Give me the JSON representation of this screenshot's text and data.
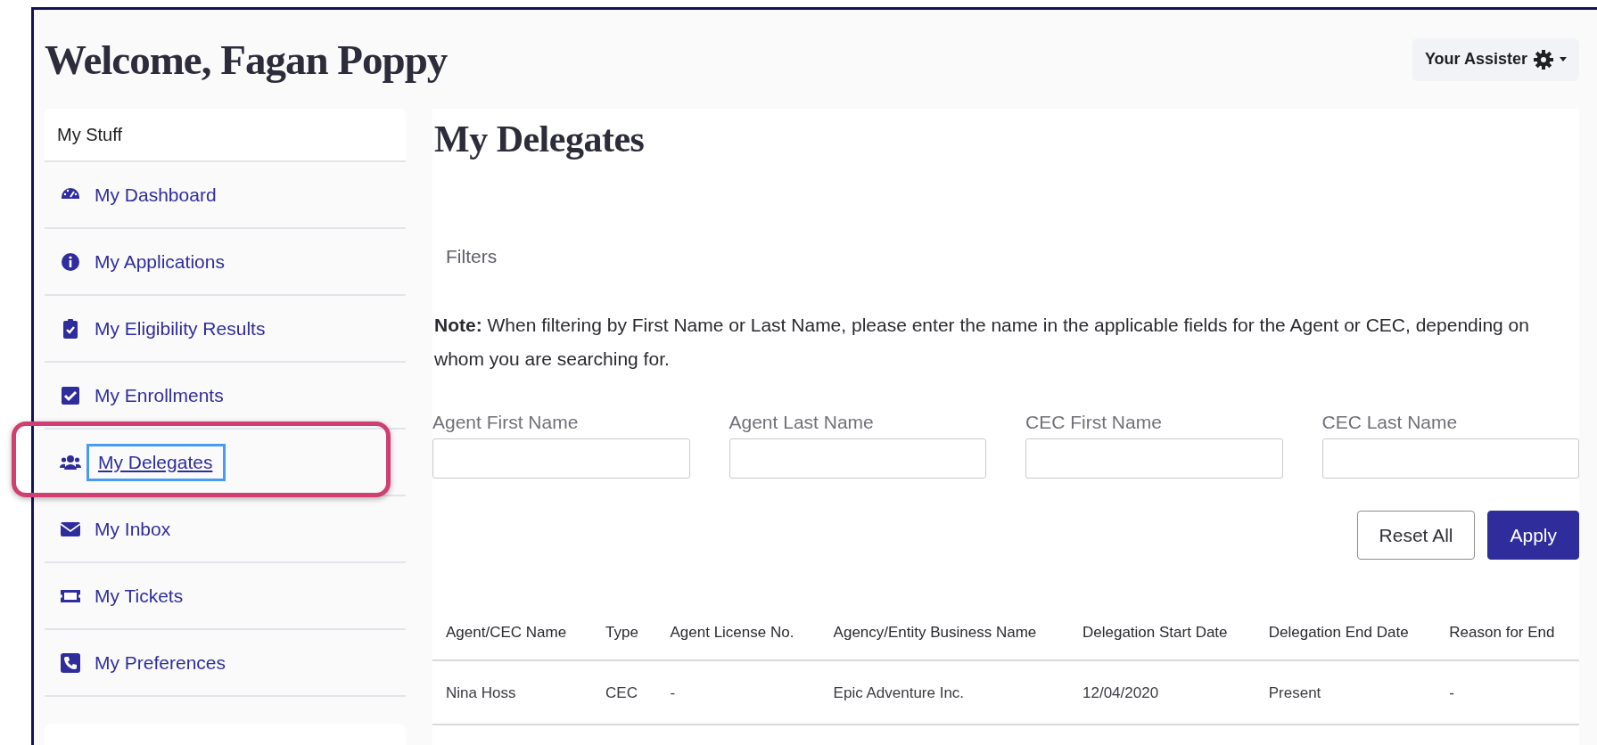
{
  "header": {
    "title": "Welcome, Fagan Poppy",
    "user_menu": "Your Assister"
  },
  "sidebar": {
    "title": "My Stuff",
    "items": [
      {
        "label": "My Dashboard",
        "selected": false
      },
      {
        "label": "My Applications",
        "selected": false
      },
      {
        "label": "My Eligibility Results",
        "selected": false
      },
      {
        "label": "My Enrollments",
        "selected": false
      },
      {
        "label": "My Delegates",
        "selected": true
      },
      {
        "label": "My Inbox",
        "selected": false
      },
      {
        "label": "My Tickets",
        "selected": false
      },
      {
        "label": "My Preferences",
        "selected": false
      }
    ]
  },
  "main": {
    "title": "My Delegates",
    "filters_title": "Filters",
    "note": "**Note:** When filtering by First Name or Last Name, please enter the name in the applicable fields for the Agent or CEC, depending on whom you are searching for.",
    "fields": [
      {
        "label": "Agent First Name"
      },
      {
        "label": "Agent Last Name"
      },
      {
        "label": "CEC First Name"
      },
      {
        "label": "CEC Last Name"
      }
    ],
    "buttons": [
      {
        "label": "Reset All",
        "kind": "secondary"
      },
      {
        "label": "Apply",
        "kind": "primary"
      }
    ],
    "table": {
      "columns": [
        "Agent/CEC Name",
        "Type",
        "Agent License No.",
        "Agency/Entity Business Name",
        "Delegation Start Date",
        "Delegation End Date",
        "Reason for End"
      ],
      "rows": [
        [
          "Nina Hoss",
          "CEC",
          "-",
          "Epic Adventure Inc.",
          "12/04/2020",
          "Present",
          "-"
        ]
      ]
    }
  }
}
